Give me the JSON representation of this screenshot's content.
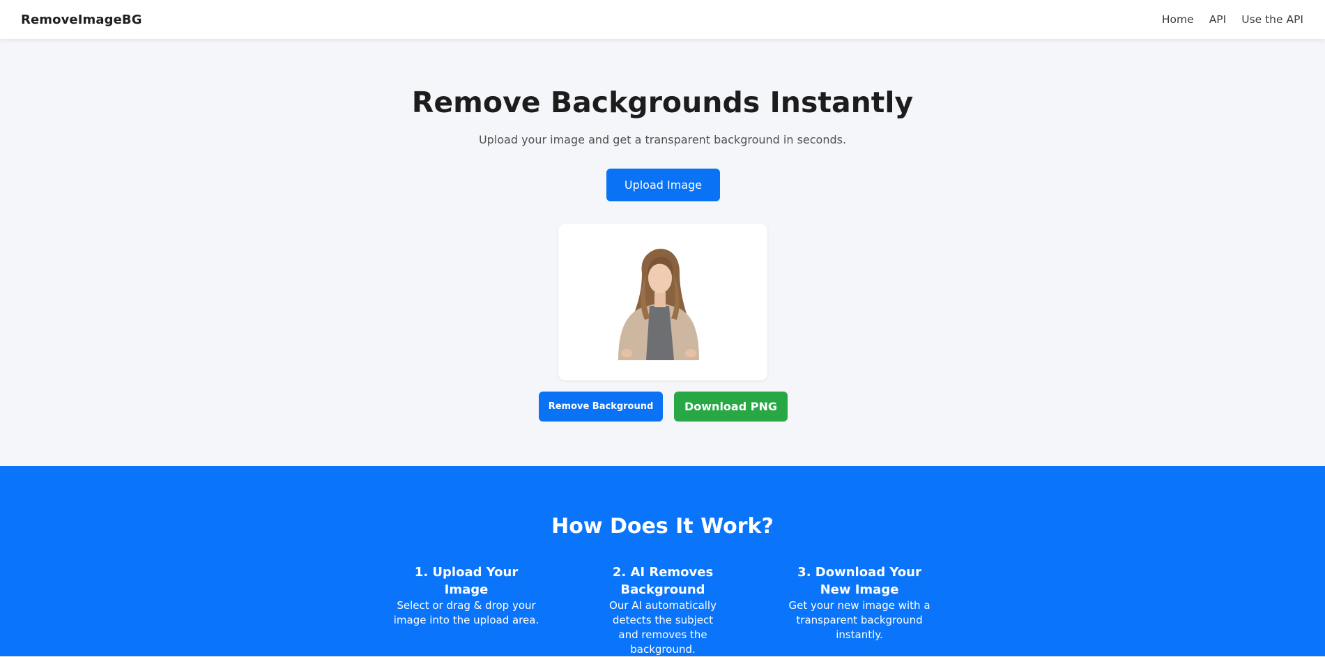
{
  "navbar": {
    "brand": "RemoveImageBG",
    "links": [
      "Home",
      "API",
      "Use the API"
    ]
  },
  "hero": {
    "title": "Remove Backgrounds Instantly",
    "subtitle": "Upload your image and get a transparent background in seconds.",
    "upload_label": "Upload Image",
    "preview_image": "woman-portrait-transparent-background",
    "remove_label": "Remove Background",
    "download_label": "Download PNG"
  },
  "how": {
    "title": "How Does It Work?",
    "steps": [
      {
        "title": "1. Upload Your Image",
        "desc": "Select or drag & drop your image into the upload area."
      },
      {
        "title": "2. AI Removes Background",
        "desc": "Our AI automatically detects the subject and removes the background."
      },
      {
        "title": "3. Download Your New Image",
        "desc": "Get your new image with a transparent background instantly."
      }
    ]
  },
  "colors": {
    "primary": "#0a72f5",
    "success": "#28a745",
    "section_blue": "#0a75fa",
    "page_bg": "#f5f6fa"
  }
}
